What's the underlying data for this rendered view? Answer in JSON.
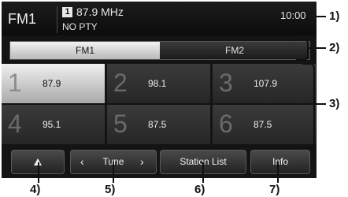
{
  "status": {
    "band": "FM1",
    "preset_badge": "1",
    "frequency": "87.9 MHz",
    "pty": "NO PTY",
    "clock": "10:00"
  },
  "tabs": [
    {
      "label": "FM1",
      "selected": true
    },
    {
      "label": "FM2",
      "selected": false
    }
  ],
  "presets": [
    {
      "number": "1",
      "frequency": "87.9",
      "selected": true
    },
    {
      "number": "2",
      "frequency": "98.1",
      "selected": false
    },
    {
      "number": "3",
      "frequency": "107.9",
      "selected": false
    },
    {
      "number": "4",
      "frequency": "95.1",
      "selected": false
    },
    {
      "number": "5",
      "frequency": "87.5",
      "selected": false
    },
    {
      "number": "6",
      "frequency": "87.5",
      "selected": false
    }
  ],
  "buttons": {
    "up_icon": "triangle-up-icon",
    "tune_label": "Tune",
    "tune_prev": "‹",
    "tune_next": "›",
    "station_list_label": "Station List",
    "info_label": "Info"
  },
  "callouts": {
    "c1": "1)",
    "c2": "2)",
    "c3": "3)",
    "c4": "4)",
    "c5": "5)",
    "c6": "6)",
    "c7": "7)"
  },
  "colors": {
    "screen_bg": "#141414",
    "selected_bg": "#e6e6e6",
    "text": "#f0f0f0"
  }
}
